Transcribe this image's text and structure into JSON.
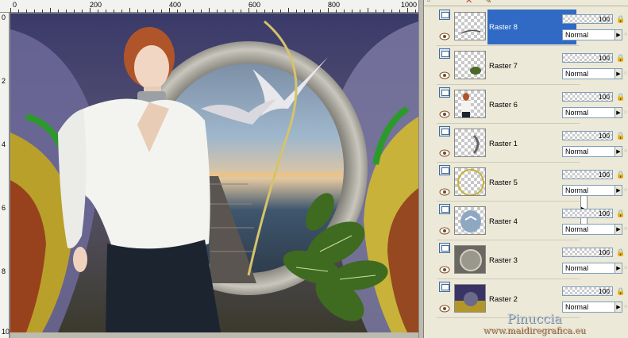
{
  "ruler": {
    "top_labels": [
      "0",
      "200",
      "400",
      "600",
      "800",
      "1000"
    ],
    "left_labels": [
      "0",
      "2",
      "4",
      "6",
      "8",
      "10"
    ]
  },
  "layers": [
    {
      "name": "Raster 8",
      "selected": true,
      "thumb": "strokes"
    },
    {
      "name": "Raster 7",
      "selected": false,
      "thumb": "plant-small"
    },
    {
      "name": "Raster 6",
      "selected": false,
      "thumb": "woman"
    },
    {
      "name": "Raster 1",
      "selected": false,
      "thumb": "swirl"
    },
    {
      "name": "Raster 5",
      "selected": false,
      "thumb": "frame"
    },
    {
      "name": "Raster 4",
      "selected": false,
      "thumb": "birds"
    },
    {
      "name": "Raster 3",
      "selected": false,
      "thumb": "circle"
    },
    {
      "name": "Raster 2",
      "selected": false,
      "thumb": "background"
    }
  ],
  "layer_props": [
    {
      "opacity": "100",
      "blend": "Normal"
    },
    {
      "opacity": "100",
      "blend": "Normal"
    },
    {
      "opacity": "100",
      "blend": "Normal"
    },
    {
      "opacity": "100",
      "blend": "Normal"
    },
    {
      "opacity": "100",
      "blend": "Normal"
    },
    {
      "opacity": "100",
      "blend": "Normal"
    },
    {
      "opacity": "100",
      "blend": "Normal"
    },
    {
      "opacity": "100",
      "blend": "Normal"
    }
  ],
  "watermark": {
    "name": "Pinuccia",
    "site": "www.maidiregrafica.eu"
  },
  "colors": {
    "selection": "#316ac5",
    "panel": "#ece9d8"
  }
}
